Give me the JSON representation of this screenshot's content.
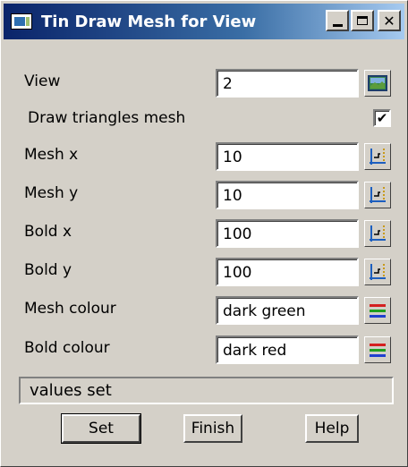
{
  "window": {
    "title": "Tin Draw Mesh for View",
    "minimize_icon": "minimize-icon",
    "maximize_icon": "maximize-icon",
    "close_glyph": "✕"
  },
  "form": {
    "view": {
      "label": "View",
      "value": "2",
      "button_icon": "view-picker-icon"
    },
    "draw_triangles": {
      "label": "Draw triangles mesh",
      "checked": true,
      "check_glyph": "✔"
    },
    "mesh_x": {
      "label": "Mesh x",
      "value": "10",
      "button_icon": "pick-value-icon"
    },
    "mesh_y": {
      "label": "Mesh y",
      "value": "10",
      "button_icon": "pick-value-icon"
    },
    "bold_x": {
      "label": "Bold x",
      "value": "100",
      "button_icon": "pick-value-icon"
    },
    "bold_y": {
      "label": "Bold y",
      "value": "100",
      "button_icon": "pick-value-icon"
    },
    "mesh_colour": {
      "label": "Mesh colour",
      "value": "dark green",
      "button_icon": "colour-list-icon"
    },
    "bold_colour": {
      "label": "Bold colour",
      "value": "dark red",
      "button_icon": "colour-list-icon"
    }
  },
  "status": {
    "text": "values set"
  },
  "buttons": {
    "set": "Set",
    "finish": "Finish",
    "help": "Help"
  },
  "colors": {
    "title_gradient_start": "#0a246a",
    "title_gradient_end": "#a6caf0",
    "face": "#d4d0c8"
  }
}
